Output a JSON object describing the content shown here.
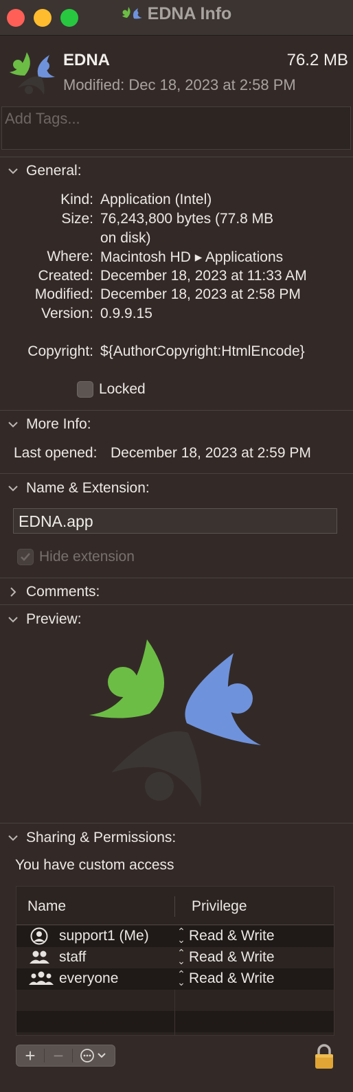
{
  "window": {
    "title": "EDNA Info"
  },
  "header": {
    "name": "EDNA",
    "size": "76.2 MB",
    "modified": "Modified: Dec 18, 2023 at 2:58 PM",
    "tags_placeholder": "Add Tags..."
  },
  "general": {
    "title": "General:",
    "rows": [
      {
        "label": "Kind:",
        "value": "Application (Intel)"
      },
      {
        "label": "Size:",
        "value": "76,243,800 bytes (77.8 MB",
        "value2": "on disk)"
      },
      {
        "label": "Where:",
        "value": "Macintosh HD ▸ Applications"
      },
      {
        "label": "Created:",
        "value": "December 18, 2023 at 11:33 AM"
      },
      {
        "label": "Modified:",
        "value": "December 18, 2023 at 2:58 PM"
      },
      {
        "label": "Version:",
        "value": "0.9.9.15"
      },
      {
        "label": "Copyright:",
        "value": "${AuthorCopyright:HtmlEncode}"
      }
    ],
    "locked_label": "Locked"
  },
  "more_info": {
    "title": "More Info:",
    "last_opened_label": "Last opened:",
    "last_opened_value": "December 18, 2023 at 2:59 PM"
  },
  "name_extension": {
    "title": "Name & Extension:",
    "value": "EDNA.app",
    "hide_extension_label": "Hide extension"
  },
  "comments": {
    "title": "Comments:"
  },
  "preview": {
    "title": "Preview:"
  },
  "sharing": {
    "title": "Sharing & Permissions:",
    "note": "You have custom access",
    "columns": {
      "name": "Name",
      "privilege": "Privilege"
    },
    "rows": [
      {
        "name": "support1 (Me)",
        "privilege": "Read & Write",
        "icon": "user-icon"
      },
      {
        "name": "staff",
        "privilege": "Read & Write",
        "icon": "group-icon"
      },
      {
        "name": "everyone",
        "privilege": "Read & Write",
        "icon": "everyone-icon"
      }
    ],
    "add_symbol": "+",
    "remove_symbol": "−"
  },
  "colors": {
    "background": "#332a27",
    "logo_green": "#6cbd45",
    "logo_blue": "#6f92dc",
    "logo_dark": "#3a3634"
  }
}
